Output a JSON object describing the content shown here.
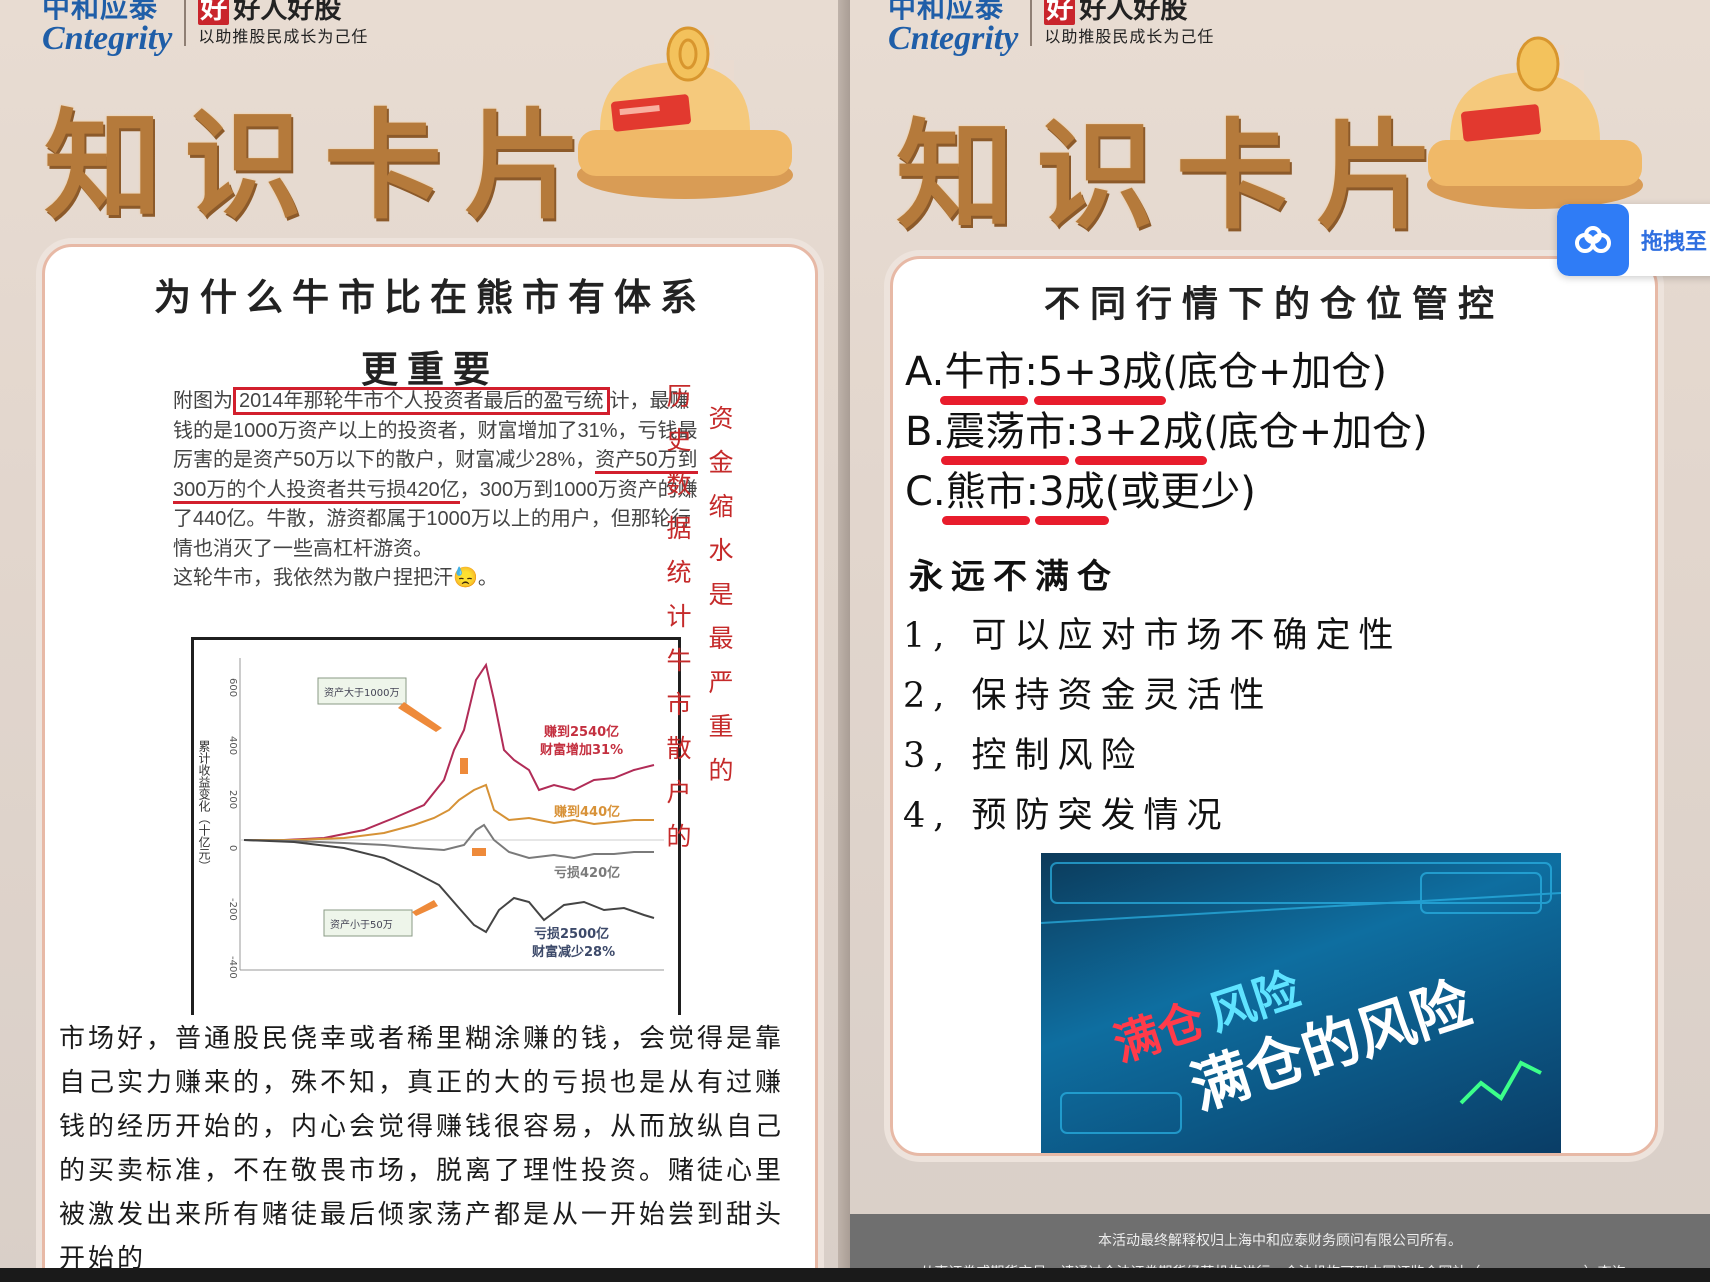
{
  "left": {
    "logo_cn": "中和应泰",
    "logo_en": "ntegrity",
    "slogan_hao": "好",
    "slogan_main": "好人好股",
    "slogan_sub": "以助推股民成长为己任",
    "big_title": "知识卡片",
    "question_line1": "为什么牛市比在熊市有体系",
    "question_line2": "更重要",
    "clip": {
      "lead": "附图为",
      "boxed": "2014年那轮牛市个人投资者最后的盈亏统",
      "text1": "计，最赚钱的是1000万资产以上的投资者，财富增加了31%，亏钱最厉害的是资产50万以下的散户，财富减少28%，",
      "underline1": "资产50万到300万的个人投资者共",
      "underline2": "亏损420亿",
      "text2": "，300万到1000万资产的赚了440亿。牛散，游资都属于1000万以上的用户，但那轮行情也消灭了一些高杠杆游资。",
      "text3": "这轮牛市，我依然为散户捏把汗😓。"
    },
    "chart_labels": {
      "ylabel": "累计收益变化（十亿元）",
      "box_top": "资产大于1000万",
      "box_bottom": "资产小于50万",
      "earn_top_1": "赚到2540亿",
      "earn_top_2": "财富增加31%",
      "earn_mid": "赚到440亿",
      "loss_mid": "亏损420亿",
      "loss_bottom_1": "亏损2500亿",
      "loss_bottom_2": "财富减少28%",
      "yticks": [
        "600",
        "400",
        "200",
        "0",
        "-200",
        "-400"
      ]
    },
    "vertical_col1": "历史数据统计牛市散户的",
    "vertical_col2": "资金缩水是最严重的",
    "paragraph": "市场好，普通股民侥幸或者稀里糊涂赚的钱，会觉得是靠自己实力赚来的，殊不知，真正的大的亏损也是从有过赚钱的经历开始的，内心会觉得赚钱很容易，从而放纵自己的买卖标准，不在敬畏市场，脱离了理性投资。赌徒心里被激发出来所有赌徒最后倾家荡产都是从一开始尝到甜头开始的"
  },
  "right": {
    "logo_cn": "中和应泰",
    "logo_en": "ntegrity",
    "slogan_hao": "好",
    "slogan_main": "好人好股",
    "slogan_sub": "以助推股民成长为己任",
    "big_title": "知识卡片",
    "title": "不同行情下的仓位管控",
    "options": [
      {
        "prefix": "A.",
        "market": "牛市",
        "colon": ":",
        "ratio": "5+3成",
        "note": "(底仓+加仓)"
      },
      {
        "prefix": "B.",
        "market": "震荡市",
        "colon": ":",
        "ratio": "3+2成",
        "note": "(底仓+加仓)"
      },
      {
        "prefix": "C.",
        "market": "熊市",
        "colon": ":",
        "ratio": "3成",
        "note": "(或更少)"
      }
    ],
    "section": "永远不满仓",
    "items": [
      "1, 可以应对市场不确定性",
      "2, 保持资金灵活性",
      "3, 控制风险",
      "4, 预防突发情况"
    ],
    "photo_text_1": "满仓的风险",
    "photo_text_2": "满仓",
    "photo_text_3": "风险",
    "footer_line1": "本活动最终解释权归上海中和应泰财务顾问有限公司所有。",
    "footer_line2": "从事证券或期货交易，请通过合法证券期货经营机构进行。合法机构可到中国证监会网站（www.csrc.gov.cn）查询。"
  },
  "overlay": {
    "cloud_label": "拖拽至",
    "cloud_icon": "cloud-icon"
  },
  "colors": {
    "title_brown": "#b57a3b",
    "accent_red": "#d21f2d",
    "logo_blue": "#1f5ea8",
    "overlay_blue": "#2f7cf6"
  }
}
